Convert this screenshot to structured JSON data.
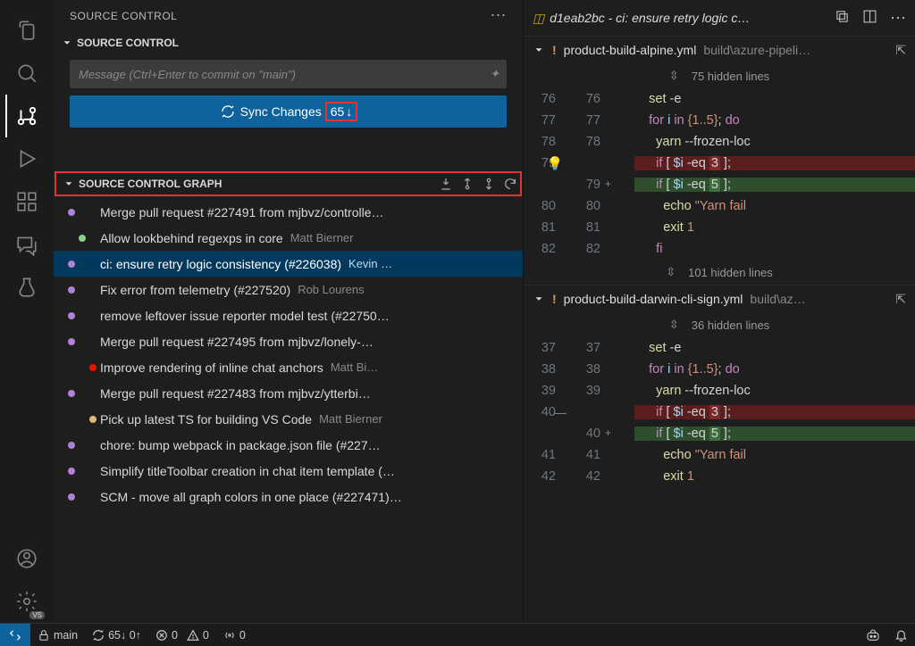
{
  "sidebar": {
    "title": "SOURCE CONTROL",
    "section_label": "SOURCE CONTROL",
    "commit_placeholder": "Message (Ctrl+Enter to commit on \"main\")",
    "sync_label": "Sync Changes",
    "sync_count": "65",
    "graph_label": "SOURCE CONTROL GRAPH"
  },
  "commits": [
    {
      "msg": "Merge pull request #227491 from mjbvz/controlle…",
      "author": "",
      "dot": "#b180d7",
      "x": 8
    },
    {
      "msg": "Allow lookbehind regexps in core",
      "author": "Matt Bierner",
      "dot": "#89d185",
      "x": 20
    },
    {
      "msg": "ci: ensure retry logic consistency (#226038)",
      "author": "Kevin …",
      "dot": "#b180d7",
      "x": 8,
      "selected": true
    },
    {
      "msg": "Fix error from telemetry (#227520)",
      "author": "Rob Lourens",
      "dot": "#b180d7",
      "x": 8
    },
    {
      "msg": "remove leftover issue reporter model test (#22750…",
      "author": "",
      "dot": "#b180d7",
      "x": 8
    },
    {
      "msg": "Merge pull request #227495 from mjbvz/lonely-…",
      "author": "",
      "dot": "#b180d7",
      "x": 8
    },
    {
      "msg": "Improve rendering of inline chat anchors",
      "author": "Matt Bi…",
      "dot": "#e51400",
      "x": 32
    },
    {
      "msg": "Merge pull request #227483 from mjbvz/ytterbi…",
      "author": "",
      "dot": "#b180d7",
      "x": 8
    },
    {
      "msg": "Pick up latest TS for building VS Code",
      "author": "Matt Bierner",
      "dot": "#d7ba7d",
      "x": 32
    },
    {
      "msg": "chore: bump webpack in package.json file (#227…",
      "author": "",
      "dot": "#b180d7",
      "x": 8
    },
    {
      "msg": "Simplify titleToolbar creation in chat item template (…",
      "author": "",
      "dot": "#b180d7",
      "x": 8
    },
    {
      "msg": "SCM - move all graph colors in one place (#227471)…",
      "author": "",
      "dot": "#b180d7",
      "x": 8
    }
  ],
  "editor": {
    "tab_title": "d1eab2bc - ci: ensure retry logic c…",
    "files": [
      {
        "name": "product-build-alpine.yml",
        "path": "build\\azure-pipeli…",
        "fold_top": "75 hidden lines",
        "fold_bottom": "101 hidden lines",
        "lines": [
          {
            "l": "76",
            "r": "76",
            "type": "ctx",
            "text": "    set -e"
          },
          {
            "l": "77",
            "r": "77",
            "type": "ctx",
            "text": "    for i in {1..5}; do"
          },
          {
            "l": "78",
            "r": "78",
            "type": "ctx",
            "text": "      yarn --frozen-loc"
          },
          {
            "l": "79",
            "r": "",
            "type": "del",
            "bulb": true,
            "text": "      if [ $i -eq 3 ];"
          },
          {
            "l": "",
            "r": "79",
            "type": "add",
            "plus": true,
            "text": "      if [ $i -eq 5 ];"
          },
          {
            "l": "80",
            "r": "80",
            "type": "ctx",
            "text": "        echo \"Yarn fail"
          },
          {
            "l": "81",
            "r": "81",
            "type": "ctx",
            "text": "        exit 1"
          },
          {
            "l": "82",
            "r": "82",
            "type": "ctx",
            "text": "      fi"
          }
        ]
      },
      {
        "name": "product-build-darwin-cli-sign.yml",
        "path": "build\\az…",
        "fold_top": "36 hidden lines",
        "lines": [
          {
            "l": "37",
            "r": "37",
            "type": "ctx",
            "text": "    set -e"
          },
          {
            "l": "38",
            "r": "38",
            "type": "ctx",
            "text": "    for i in {1..5}; do"
          },
          {
            "l": "39",
            "r": "39",
            "type": "ctx",
            "text": "      yarn --frozen-loc"
          },
          {
            "l": "40",
            "r": "",
            "type": "del",
            "minus": true,
            "text": "      if [ $i -eq 3 ];"
          },
          {
            "l": "",
            "r": "40",
            "type": "add",
            "plus": true,
            "text": "      if [ $i -eq 5 ];"
          },
          {
            "l": "41",
            "r": "41",
            "type": "ctx",
            "text": "        echo \"Yarn fail"
          },
          {
            "l": "42",
            "r": "42",
            "type": "ctx",
            "text": "        exit 1"
          }
        ]
      }
    ]
  },
  "status": {
    "branch": "main",
    "sync": "65↓ 0↑",
    "errors": "0",
    "warnings": "0",
    "ports": "0"
  }
}
